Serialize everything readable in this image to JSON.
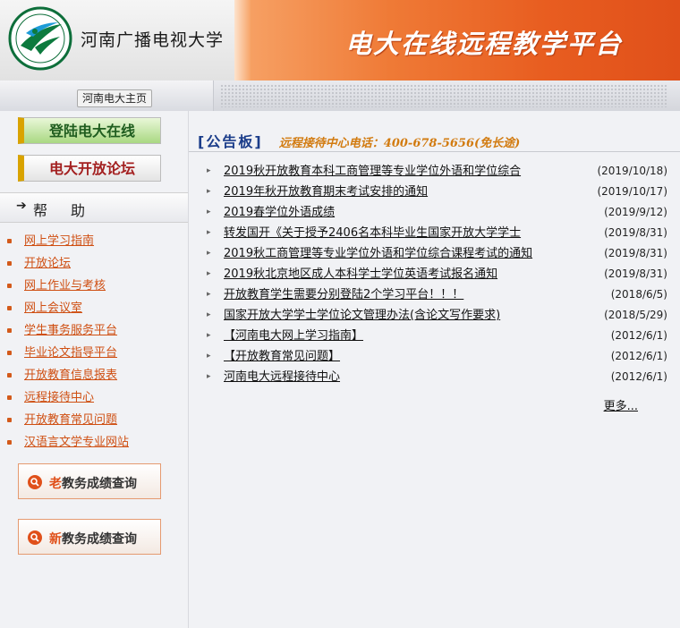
{
  "header": {
    "school_name": "河南广播电视大学",
    "banner_title": "电大在线远程教学平台"
  },
  "nav": {
    "home_label": "河南电大主页"
  },
  "sidebar": {
    "login_label": "登陆电大在线",
    "forum_label": "电大开放论坛",
    "help_arrow": "➔",
    "help_label": "帮助",
    "links": [
      "网上学习指南",
      "开放论坛",
      "网上作业与考核",
      "网上会议室",
      "学生事务服务平台",
      "毕业论文指导平台",
      "开放教育信息报表",
      "远程接待中心",
      "开放教育常见问题",
      "汉语言文学专业网站"
    ],
    "query_old": {
      "mark": "老",
      "text": "教务成绩查询"
    },
    "query_new": {
      "mark": "新",
      "text": "教务成绩查询"
    }
  },
  "main": {
    "notice_title": "[公告板]",
    "hotline": "远程接待中心电话：400-678-5656(免长途)",
    "notices": [
      {
        "title": "2019秋开放教育本科工商管理等专业学位外语和学位综合",
        "date": "(2019/10/18)"
      },
      {
        "title": "2019年秋开放教育期末考试安排的通知",
        "date": "(2019/10/17)"
      },
      {
        "title": "2019春学位外语成绩",
        "date": "(2019/9/12)"
      },
      {
        "title": "转发国开《关于授予2406名本科毕业生国家开放大学学士",
        "date": "(2019/8/31)"
      },
      {
        "title": "2019秋工商管理等专业学位外语和学位综合课程考试的通知",
        "date": "(2019/8/31)"
      },
      {
        "title": "2019秋北京地区成人本科学士学位英语考试报名通知",
        "date": "(2019/8/31)"
      },
      {
        "title": "开放教育学生需要分别登陆2个学习平台！！！",
        "date": "(2018/6/5)"
      },
      {
        "title": "国家开放大学学士学位论文管理办法(含论文写作要求)",
        "date": "(2018/5/29)"
      },
      {
        "title": "【河南电大网上学习指南】",
        "date": "(2012/6/1)"
      },
      {
        "title": "【开放教育常见问题】",
        "date": "(2012/6/1)"
      },
      {
        "title": "河南电大远程接待中心",
        "date": "(2012/6/1)"
      }
    ],
    "more_label": "更多..."
  },
  "colors": {
    "banner_orange": "#e85d20",
    "link_orange": "#cf4f12",
    "notice_blue": "#1b3d8a",
    "hotline_orange": "#d27b10",
    "login_green": "#1f5d1f",
    "forum_red": "#a32020"
  }
}
